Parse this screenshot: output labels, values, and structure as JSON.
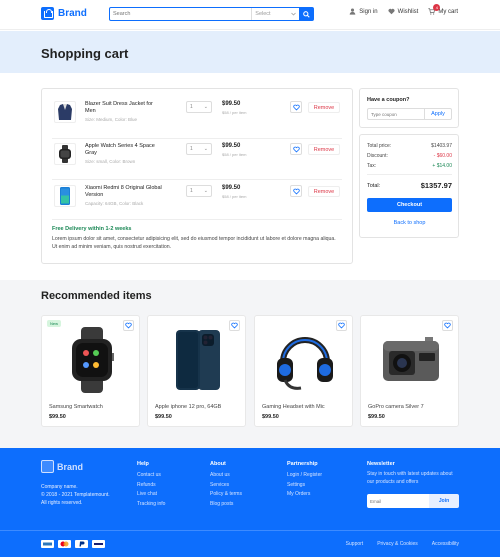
{
  "header": {
    "logo_text": "Brand",
    "search_placeholder": "Search",
    "select_label": "Select",
    "signin": "Sign in",
    "wishlist": "Wishlist",
    "cart": "My cart",
    "cart_count": "4"
  },
  "page": {
    "title": "Shopping cart"
  },
  "cart": {
    "items": [
      {
        "name": "Blazer Suit Dress Jacket for Men",
        "meta": "Size: Medium, Color: Blue",
        "qty": "1",
        "price": "$99.50",
        "unit": "$58 / per item",
        "remove": "Remove",
        "icon": "blazer-image"
      },
      {
        "name": "Apple Watch Series 4 Space Gray",
        "meta": "Size: small, Color: Brown",
        "qty": "1",
        "price": "$99.50",
        "unit": "$58 / per item",
        "remove": "Remove",
        "icon": "watch-image"
      },
      {
        "name": "Xiaomi Redmi 8 Original Global Version",
        "meta": "Capacity: 64GB, Color: Black",
        "qty": "1",
        "price": "$99.50",
        "unit": "$58 / per item",
        "remove": "Remove",
        "icon": "phone-image"
      }
    ],
    "delivery": "Free Delivery within 1-2 weeks",
    "lorem": "Lorem ipsum dolor sit amet, consectetur adipisicing elit, sed do eiusmod tempor incididunt ut labore et dolore magna aliqua. Ut enim ad minim veniam, quis nostrud exercitation."
  },
  "coupon": {
    "title": "Have a coupon?",
    "placeholder": "Type coupon",
    "apply": "Apply"
  },
  "summary": {
    "total_price_label": "Total price:",
    "total_price": "$1403.97",
    "discount_label": "Discount:",
    "discount": "- $60.00",
    "tax_label": "Tax:",
    "tax": "+ $14.00",
    "total_label": "Total:",
    "total": "$1357.97",
    "checkout": "Checkout",
    "back": "Back to shop"
  },
  "recommended": {
    "title": "Recommended items",
    "new_badge": "New",
    "items": [
      {
        "name": "Samsung Smartwatch",
        "price": "$99.50"
      },
      {
        "name": "Apple iphone 12 pro, 64GB",
        "price": "$99.50"
      },
      {
        "name": "Gaming Headset with Mic",
        "price": "$99.50"
      },
      {
        "name": "GoPro camera Silver 7",
        "price": "$99.50"
      }
    ]
  },
  "footer": {
    "logo_text": "Brand",
    "company": "Company name.",
    "copyright": "© 2018 - 2021 Templatemount.",
    "rights": "All rights reserved.",
    "help": {
      "title": "Help",
      "links": [
        "Contact us",
        "Refunds",
        "Live chat",
        "Tracking info"
      ]
    },
    "about": {
      "title": "About",
      "links": [
        "About us",
        "Services",
        "Policy & terms",
        "Blog posts"
      ]
    },
    "partnership": {
      "title": "Partnership",
      "links": [
        "Login / Register",
        "Settings",
        "My Orders"
      ]
    },
    "newsletter": {
      "title": "Newsletter",
      "desc": "Stay in touch with latest updates about our products and offers",
      "placeholder": "Email",
      "join": "Join"
    },
    "bottom_links": [
      "Support",
      "Privacy & Cookies",
      "Accessibility"
    ]
  },
  "colors": {
    "primary": "#0d6efd",
    "danger": "#dc3545",
    "success": "#198754",
    "band": "#e3eefc"
  }
}
